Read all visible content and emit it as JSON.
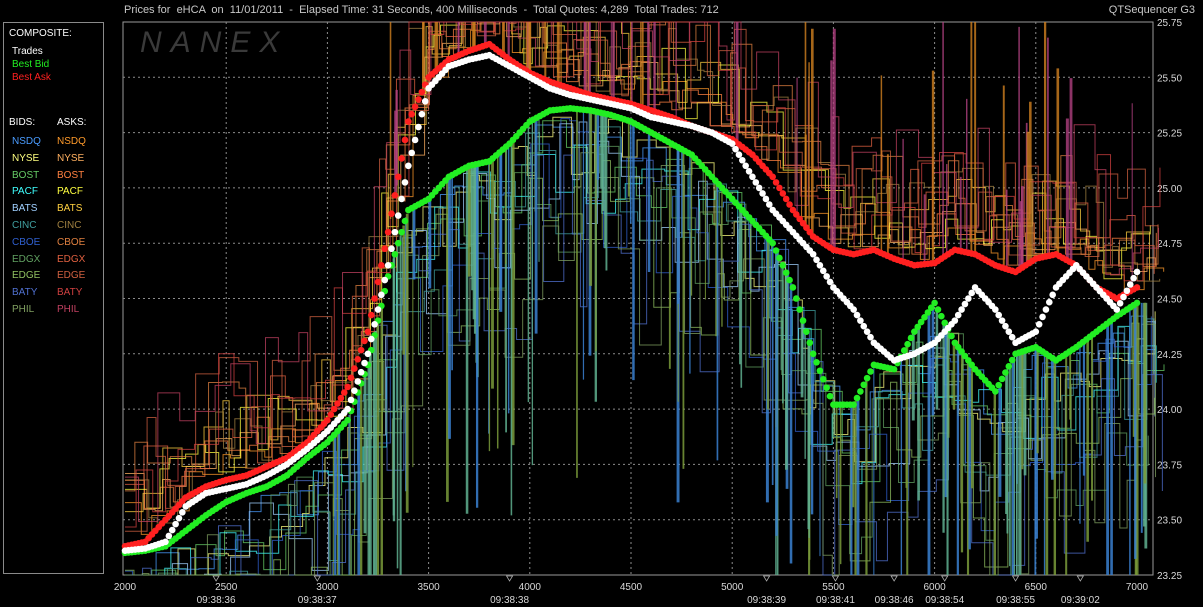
{
  "header": {
    "title": "Prices for  eHCA  on  11/01/2011  -  Elapsed Time: 31 Seconds, 400 Milliseconds  -  Total Quotes: 4,289  Total Trades: 712",
    "product": "QTSequencer G3"
  },
  "watermark": "NANEX",
  "legend": {
    "composite_title": "COMPOSITE:",
    "composite": [
      {
        "label": "Trades",
        "color": "#ffffff"
      },
      {
        "label": "Best Bid",
        "color": "#22ee22"
      },
      {
        "label": "Best Ask",
        "color": "#ff2020"
      }
    ],
    "bids_title": "BIDS:",
    "asks_title": "ASKS:",
    "exchanges": [
      {
        "name": "NSDQ",
        "bid_color": "#4a9cff",
        "ask_color": "#ff9a2a"
      },
      {
        "name": "NYSE",
        "bid_color": "#ffff80",
        "ask_color": "#ffb060"
      },
      {
        "name": "BOST",
        "bid_color": "#66cc66",
        "ask_color": "#ff8040"
      },
      {
        "name": "PACF",
        "bid_color": "#40ffff",
        "ask_color": "#ffff40"
      },
      {
        "name": "BATS",
        "bid_color": "#a0d0ff",
        "ask_color": "#ffd040"
      },
      {
        "name": "CINC",
        "bid_color": "#40a0a0",
        "ask_color": "#a08040"
      },
      {
        "name": "CBOE",
        "bid_color": "#3060d0",
        "ask_color": "#e08040"
      },
      {
        "name": "EDGX",
        "bid_color": "#60a060",
        "ask_color": "#e06040"
      },
      {
        "name": "EDGE",
        "bid_color": "#90c060",
        "ask_color": "#d06040"
      },
      {
        "name": "BATY",
        "bid_color": "#5070d0",
        "ask_color": "#d04040"
      },
      {
        "name": "PHIL",
        "bid_color": "#80a060",
        "ask_color": "#c04060"
      }
    ]
  },
  "chart_data": {
    "type": "scatter",
    "title": "Prices for  eHCA  on  11/01/2011",
    "xlim": [
      2000,
      7050
    ],
    "ylim": [
      23.25,
      25.75
    ],
    "x_ticks": [
      2000,
      2500,
      3000,
      3500,
      4000,
      4500,
      5000,
      5500,
      6000,
      6500,
      7000
    ],
    "y_ticks": [
      "23.25",
      "23.50",
      "23.75",
      "24.00",
      "24.25",
      "24.50",
      "24.75",
      "25.00",
      "25.25",
      "25.50",
      "25.75"
    ],
    "time_labels": [
      {
        "x": 2450,
        "label": "09:38:36"
      },
      {
        "x": 2950,
        "label": "09:38:37"
      },
      {
        "x": 3900,
        "label": "09:38:38"
      },
      {
        "x": 5170,
        "label": "09:38:39"
      },
      {
        "x": 5510,
        "label": "09:38:41"
      },
      {
        "x": 5800,
        "label": "09:38:46"
      },
      {
        "x": 6050,
        "label": "09:38:54"
      },
      {
        "x": 6400,
        "label": "09:38:55"
      },
      {
        "x": 6720,
        "label": "09:39:02"
      }
    ],
    "grid": true,
    "series": [
      {
        "name": "Trades",
        "color": "#ffffff",
        "points": [
          [
            2000,
            23.36
          ],
          [
            2100,
            23.37
          ],
          [
            2200,
            23.4
          ],
          [
            2300,
            23.56
          ],
          [
            2400,
            23.62
          ],
          [
            2500,
            23.64
          ],
          [
            2600,
            23.66
          ],
          [
            2700,
            23.7
          ],
          [
            2800,
            23.75
          ],
          [
            2900,
            23.82
          ],
          [
            3000,
            23.9
          ],
          [
            3100,
            24.0
          ],
          [
            3200,
            24.25
          ],
          [
            3300,
            24.65
          ],
          [
            3400,
            25.1
          ],
          [
            3500,
            25.45
          ],
          [
            3600,
            25.55
          ],
          [
            3700,
            25.58
          ],
          [
            3800,
            25.6
          ],
          [
            3900,
            25.55
          ],
          [
            4000,
            25.5
          ],
          [
            4100,
            25.45
          ],
          [
            4200,
            25.42
          ],
          [
            4300,
            25.4
          ],
          [
            4400,
            25.38
          ],
          [
            4500,
            25.36
          ],
          [
            4600,
            25.32
          ],
          [
            4700,
            25.3
          ],
          [
            4800,
            25.28
          ],
          [
            4900,
            25.25
          ],
          [
            5000,
            25.2
          ],
          [
            5100,
            25.05
          ],
          [
            5200,
            24.9
          ],
          [
            5300,
            24.8
          ],
          [
            5400,
            24.7
          ],
          [
            5500,
            24.55
          ],
          [
            5600,
            24.45
          ],
          [
            5700,
            24.3
          ],
          [
            5800,
            24.22
          ],
          [
            5900,
            24.25
          ],
          [
            6000,
            24.3
          ],
          [
            6100,
            24.4
          ],
          [
            6200,
            24.55
          ],
          [
            6300,
            24.45
          ],
          [
            6400,
            24.3
          ],
          [
            6500,
            24.35
          ],
          [
            6600,
            24.55
          ],
          [
            6700,
            24.65
          ],
          [
            6800,
            24.55
          ],
          [
            6900,
            24.45
          ],
          [
            7000,
            24.62
          ]
        ]
      },
      {
        "name": "Best Bid",
        "color": "#22ee22",
        "points": [
          [
            2000,
            23.35
          ],
          [
            2100,
            23.36
          ],
          [
            2200,
            23.38
          ],
          [
            2300,
            23.45
          ],
          [
            2400,
            23.52
          ],
          [
            2500,
            23.58
          ],
          [
            2600,
            23.62
          ],
          [
            2700,
            23.65
          ],
          [
            2800,
            23.7
          ],
          [
            2900,
            23.78
          ],
          [
            3000,
            23.85
          ],
          [
            3100,
            23.95
          ],
          [
            3200,
            24.2
          ],
          [
            3300,
            24.6
          ],
          [
            3400,
            24.9
          ],
          [
            3500,
            24.95
          ],
          [
            3600,
            25.05
          ],
          [
            3700,
            25.1
          ],
          [
            3800,
            25.12
          ],
          [
            3900,
            25.2
          ],
          [
            4000,
            25.3
          ],
          [
            4100,
            25.35
          ],
          [
            4200,
            25.36
          ],
          [
            4300,
            25.35
          ],
          [
            4400,
            25.33
          ],
          [
            4500,
            25.3
          ],
          [
            4600,
            25.25
          ],
          [
            4700,
            25.2
          ],
          [
            4800,
            25.15
          ],
          [
            4900,
            25.05
          ],
          [
            5000,
            24.95
          ],
          [
            5100,
            24.85
          ],
          [
            5200,
            24.75
          ],
          [
            5300,
            24.55
          ],
          [
            5400,
            24.25
          ],
          [
            5500,
            24.02
          ],
          [
            5600,
            24.02
          ],
          [
            5700,
            24.2
          ],
          [
            5800,
            24.18
          ],
          [
            5900,
            24.35
          ],
          [
            6000,
            24.48
          ],
          [
            6100,
            24.3
          ],
          [
            6200,
            24.18
          ],
          [
            6300,
            24.08
          ],
          [
            6400,
            24.25
          ],
          [
            6500,
            24.28
          ],
          [
            6600,
            24.22
          ],
          [
            6700,
            24.28
          ],
          [
            6800,
            24.35
          ],
          [
            6900,
            24.42
          ],
          [
            7000,
            24.48
          ]
        ]
      },
      {
        "name": "Best Ask",
        "color": "#ff2020",
        "points": [
          [
            2000,
            23.38
          ],
          [
            2100,
            23.4
          ],
          [
            2200,
            23.5
          ],
          [
            2300,
            23.6
          ],
          [
            2400,
            23.65
          ],
          [
            2500,
            23.68
          ],
          [
            2600,
            23.7
          ],
          [
            2700,
            23.74
          ],
          [
            2800,
            23.78
          ],
          [
            2900,
            23.85
          ],
          [
            3000,
            23.95
          ],
          [
            3100,
            24.1
          ],
          [
            3200,
            24.35
          ],
          [
            3300,
            24.8
          ],
          [
            3400,
            25.3
          ],
          [
            3500,
            25.5
          ],
          [
            3600,
            25.58
          ],
          [
            3700,
            25.62
          ],
          [
            3800,
            25.65
          ],
          [
            3900,
            25.58
          ],
          [
            4000,
            25.52
          ],
          [
            4100,
            25.48
          ],
          [
            4200,
            25.45
          ],
          [
            4300,
            25.42
          ],
          [
            4400,
            25.4
          ],
          [
            4500,
            25.38
          ],
          [
            4600,
            25.35
          ],
          [
            4700,
            25.32
          ],
          [
            4800,
            25.28
          ],
          [
            4900,
            25.25
          ],
          [
            5000,
            25.22
          ],
          [
            5100,
            25.15
          ],
          [
            5200,
            25.05
          ],
          [
            5300,
            24.9
          ],
          [
            5400,
            24.78
          ],
          [
            5500,
            24.72
          ],
          [
            5600,
            24.7
          ],
          [
            5700,
            24.72
          ],
          [
            5800,
            24.68
          ],
          [
            5900,
            24.65
          ],
          [
            6000,
            24.66
          ],
          [
            6100,
            24.72
          ],
          [
            6200,
            24.7
          ],
          [
            6300,
            24.65
          ],
          [
            6400,
            24.62
          ],
          [
            6500,
            24.68
          ],
          [
            6600,
            24.7
          ],
          [
            6700,
            24.65
          ],
          [
            6800,
            24.55
          ],
          [
            6900,
            24.5
          ],
          [
            7000,
            24.55
          ]
        ]
      }
    ]
  }
}
